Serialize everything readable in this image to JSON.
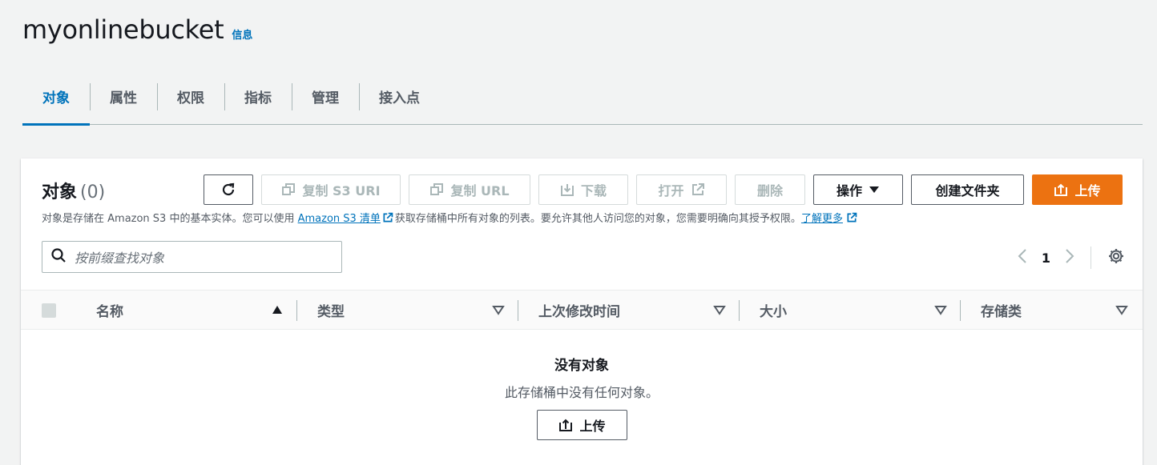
{
  "header": {
    "bucket_name": "myonlinebucket",
    "info_link": "信息"
  },
  "tabs": [
    {
      "label": "对象"
    },
    {
      "label": "属性"
    },
    {
      "label": "权限"
    },
    {
      "label": "指标"
    },
    {
      "label": "管理"
    },
    {
      "label": "接入点"
    }
  ],
  "objects_panel": {
    "title": "对象",
    "count": "(0)",
    "toolbar": {
      "copy_s3_uri": "复制 S3 URI",
      "copy_url": "复制 URL",
      "download": "下载",
      "open": "打开",
      "delete": "删除",
      "actions": "操作",
      "create_folder": "创建文件夹",
      "upload": "上传"
    },
    "description": {
      "part1": "对象是存储在 Amazon S3 中的基本实体。您可以使用 ",
      "link1": "Amazon S3 清单",
      "part2": "获取存储桶中所有对象的列表。要允许其他人访问您的对象，您需要明确向其授予权限。",
      "link2": "了解更多"
    },
    "search": {
      "placeholder": "按前缀查找对象"
    },
    "pagination": {
      "current_page": "1"
    },
    "columns": [
      "名称",
      "类型",
      "上次修改时间",
      "大小",
      "存储类"
    ],
    "empty_state": {
      "title": "没有对象",
      "subtitle": "此存储桶中没有任何对象。",
      "upload": "上传"
    }
  },
  "colors": {
    "accent": "#0073bb",
    "primary_button": "#ec7211",
    "text": "#16191f",
    "muted": "#545b64"
  }
}
